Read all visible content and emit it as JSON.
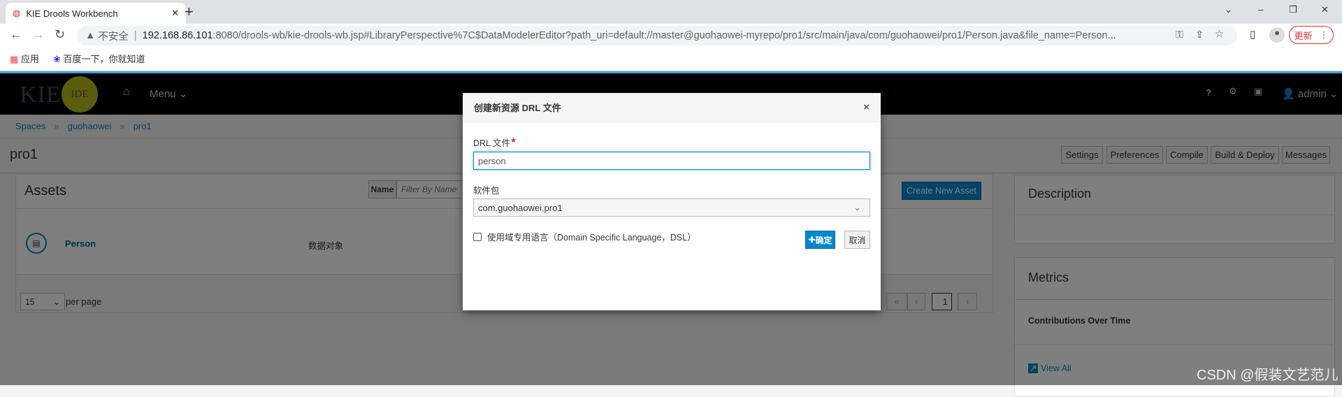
{
  "browser": {
    "tab_title": "KIE Drools Workbench",
    "new_tab": "+",
    "insecure": "不安全",
    "url_host": "192.168.86.101",
    "url_rest": ":8080/drools-wb/kie-drools-wb.jsp#LibraryPerspective%7C$DataModelerEditor?path_uri=default://master@guohaowei-myrepo/pro1/src/main/java/com/guohaowei/pro1/Person.java&file_name=Person...",
    "update_label": "更新",
    "bookmarks": [
      "应用",
      "百度一下，你就知道"
    ]
  },
  "nav": {
    "logo_kie": "KIE",
    "logo_ide": "IDE",
    "menu": "Menu",
    "help": "?",
    "user": "admin"
  },
  "breadcrumb": [
    "Spaces",
    "guohaowei",
    "pro1"
  ],
  "project": {
    "title": "pro1",
    "buttons": [
      "Settings",
      "Preferences",
      "Compile",
      "Build & Deploy",
      "Messages"
    ]
  },
  "assets": {
    "title": "Assets",
    "filter_label": "Name",
    "filter_placeholder": "Filter By Name",
    "create_button": "Create New Asset",
    "rows": [
      {
        "name": "Person",
        "type": "数据对象"
      }
    ],
    "per_page": "15",
    "per_page_label": "per page",
    "page": "1"
  },
  "side": {
    "description": "Description",
    "metrics": "Metrics",
    "contributions": "Contributions Over Time",
    "view_all": "View All"
  },
  "dialog": {
    "title": "创建新资源 DRL 文件",
    "close": "×",
    "drl_label": "DRL 文件",
    "required": "★",
    "drl_value": "person",
    "package_label": "软件包",
    "package_value": "com.guohaowei.pro1",
    "dsl_label": "使用域专用语言（Domain Specific Language，DSL）",
    "dsl_checked": false,
    "ok": "确定",
    "cancel": "取消"
  },
  "watermark": "CSDN @假装文艺范儿"
}
